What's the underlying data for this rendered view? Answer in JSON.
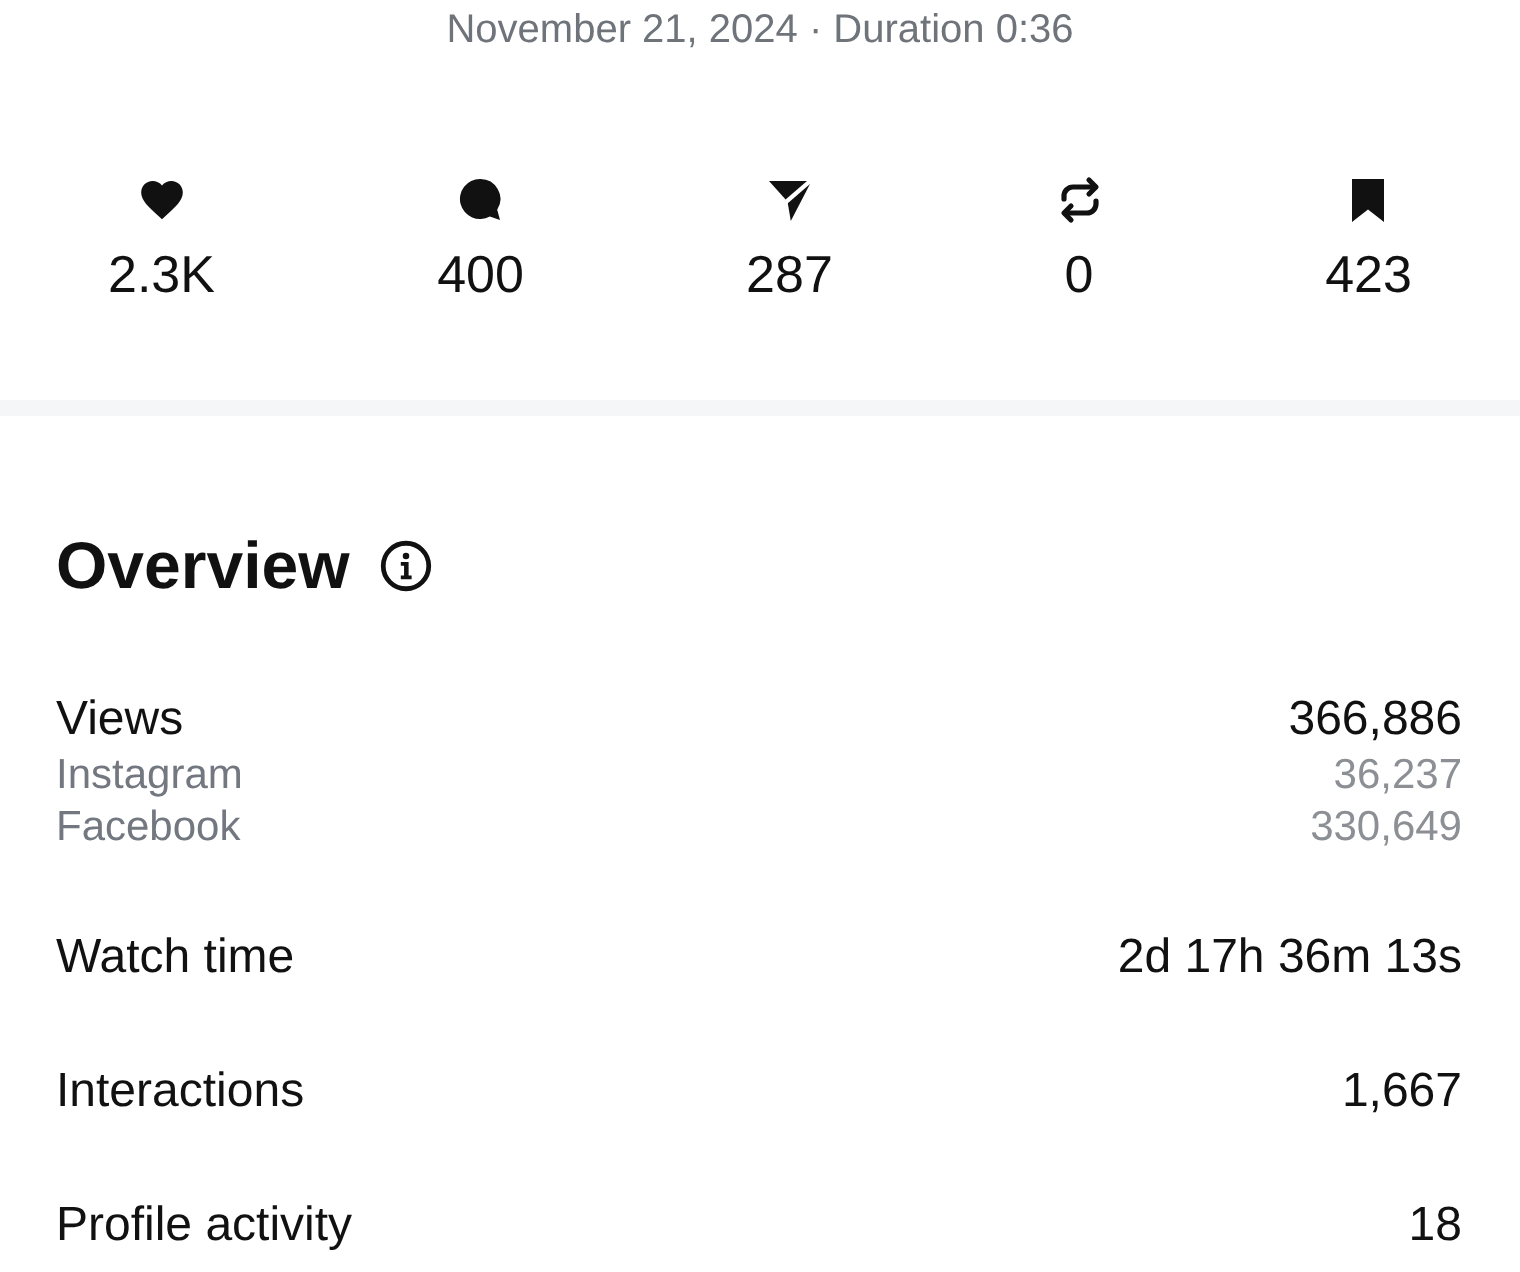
{
  "header": {
    "subtitle": "November 21, 2024 · Duration 0:36"
  },
  "stats": [
    {
      "kind": "likes",
      "value": "2.3K"
    },
    {
      "kind": "comments",
      "value": "400"
    },
    {
      "kind": "shares",
      "value": "287"
    },
    {
      "kind": "reposts",
      "value": "0"
    },
    {
      "kind": "saves",
      "value": "423"
    }
  ],
  "overview": {
    "title": "Overview",
    "metrics": [
      {
        "label": "Views",
        "value": "366,886",
        "breakdown": [
          {
            "label": "Instagram",
            "value": "36,237"
          },
          {
            "label": "Facebook",
            "value": "330,649"
          }
        ]
      },
      {
        "label": "Watch time",
        "value": "2d 17h 36m 13s"
      },
      {
        "label": "Interactions",
        "value": "1,667"
      },
      {
        "label": "Profile activity",
        "value": "18"
      }
    ]
  }
}
